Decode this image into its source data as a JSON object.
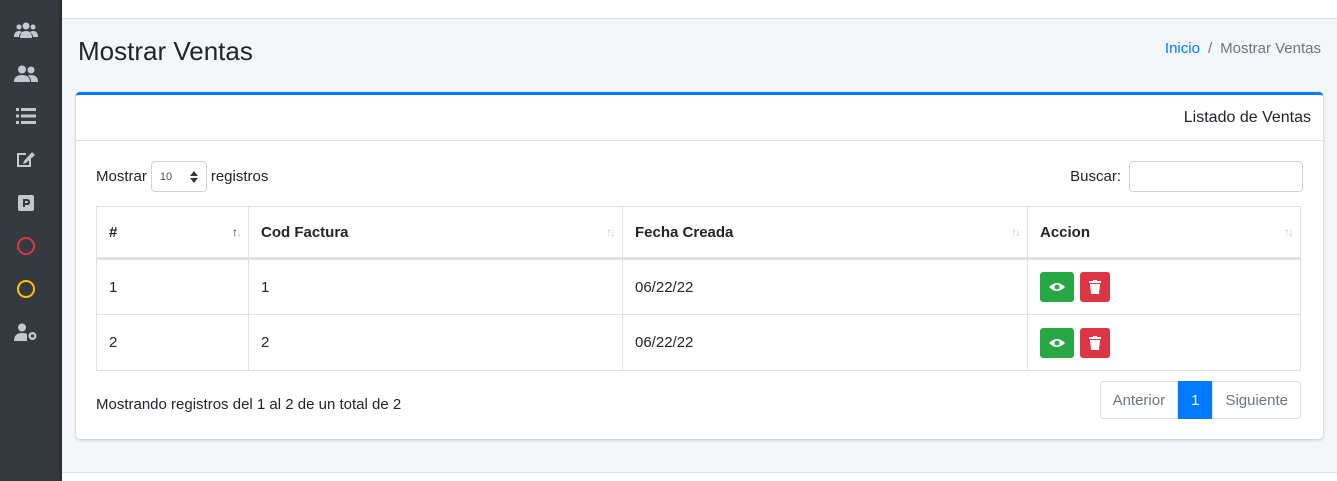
{
  "sidebar": {
    "icons": [
      {
        "name": "users-group-icon"
      },
      {
        "name": "user-friends-icon"
      },
      {
        "name": "list-icon"
      },
      {
        "name": "edit-icon"
      },
      {
        "name": "parking-icon"
      },
      {
        "name": "circle-red-icon",
        "color": "#dc3545"
      },
      {
        "name": "circle-yellow-icon",
        "color": "#ffc107"
      },
      {
        "name": "user-cog-icon"
      }
    ]
  },
  "header": {
    "title": "Mostrar Ventas",
    "breadcrumb": {
      "home": "Inicio",
      "separator": "/",
      "current": "Mostrar Ventas"
    }
  },
  "card": {
    "title": "Listado de Ventas",
    "length": {
      "prefix": "Mostrar",
      "value": "10",
      "suffix": "registros"
    },
    "search": {
      "label": "Buscar:",
      "value": ""
    },
    "table": {
      "columns": [
        "#",
        "Cod Factura",
        "Fecha Creada",
        "Accion"
      ],
      "rows": [
        {
          "num": "1",
          "cod": "1",
          "fecha": "06/22/22"
        },
        {
          "num": "2",
          "cod": "2",
          "fecha": "06/22/22"
        }
      ]
    },
    "info": "Mostrando registros del 1 al 2 de un total de 2",
    "pagination": {
      "prev": "Anterior",
      "current": "1",
      "next": "Siguiente"
    }
  },
  "colors": {
    "primary": "#007bff",
    "success": "#28a745",
    "danger": "#dc3545",
    "sidebar": "#343a40"
  }
}
